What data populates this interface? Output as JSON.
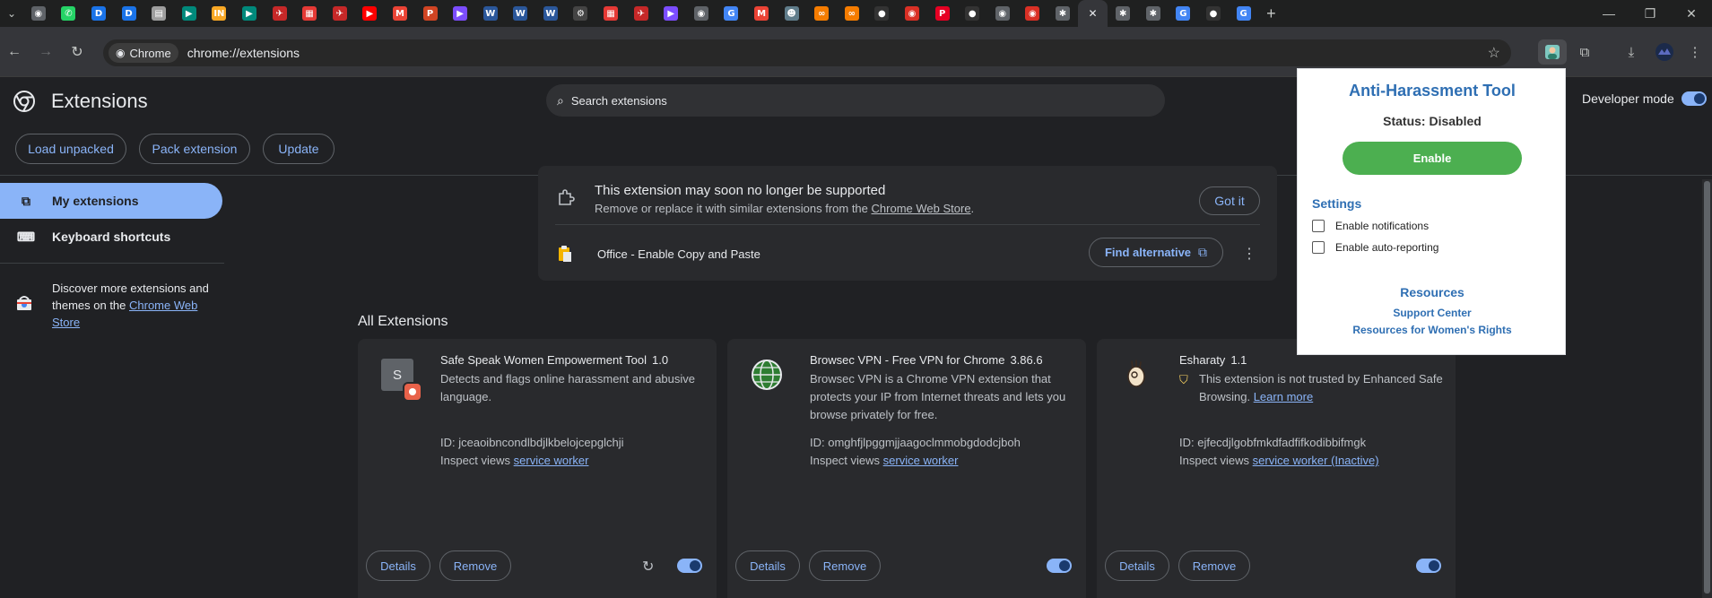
{
  "browser": {
    "tabs": [
      {
        "icon": "browser-icon",
        "color": "#5f6368",
        "glyph": "◉"
      },
      {
        "icon": "whatsapp-icon",
        "color": "#25d366",
        "glyph": "✆"
      },
      {
        "icon": "d-icon",
        "color": "#1a73e8",
        "glyph": "D"
      },
      {
        "icon": "d-icon",
        "color": "#1a73e8",
        "glyph": "D"
      },
      {
        "icon": "doc-icon",
        "color": "#9e9e9e",
        "glyph": "▤"
      },
      {
        "icon": "meet-icon",
        "color": "#00897b",
        "glyph": "▶"
      },
      {
        "icon": "in-icon",
        "color": "#f9a825",
        "glyph": "IN"
      },
      {
        "icon": "meet-icon",
        "color": "#00897b",
        "glyph": "▶"
      },
      {
        "icon": "airplane-icon",
        "color": "#c62828",
        "glyph": "✈"
      },
      {
        "icon": "calendar-icon",
        "color": "#e53935",
        "glyph": "▦"
      },
      {
        "icon": "airplane-icon",
        "color": "#c62828",
        "glyph": "✈"
      },
      {
        "icon": "youtube-icon",
        "color": "#ff0000",
        "glyph": "▶"
      },
      {
        "icon": "gmail-icon",
        "color": "#ea4335",
        "glyph": "M"
      },
      {
        "icon": "powerpoint-icon",
        "color": "#d04423",
        "glyph": "P"
      },
      {
        "icon": "play-icon",
        "color": "#7c4dff",
        "glyph": "▶"
      },
      {
        "icon": "word-icon",
        "color": "#2b579a",
        "glyph": "W"
      },
      {
        "icon": "word-icon",
        "color": "#2b579a",
        "glyph": "W"
      },
      {
        "icon": "word-icon",
        "color": "#2b579a",
        "glyph": "W"
      },
      {
        "icon": "openai-icon",
        "color": "#444444",
        "glyph": "⚙"
      },
      {
        "icon": "calendar-icon",
        "color": "#e53935",
        "glyph": "▦"
      },
      {
        "icon": "airplane-icon",
        "color": "#c62828",
        "glyph": "✈"
      },
      {
        "icon": "play-icon",
        "color": "#7c4dff",
        "glyph": "▶"
      },
      {
        "icon": "chrome-icon",
        "color": "#5f6368",
        "glyph": "◉"
      },
      {
        "icon": "google-icon",
        "color": "#4285f4",
        "glyph": "G"
      },
      {
        "icon": "gmail-icon",
        "color": "#ea4335",
        "glyph": "M"
      },
      {
        "icon": "owl-icon",
        "color": "#607d8b",
        "glyph": "☻"
      },
      {
        "icon": "infinity-icon",
        "color": "#f57c00",
        "glyph": "∞"
      },
      {
        "icon": "infinity-icon",
        "color": "#f57c00",
        "glyph": "∞"
      },
      {
        "icon": "github-icon",
        "color": "#333333",
        "glyph": "●"
      },
      {
        "icon": "chrome-colored-icon",
        "color": "#d93025",
        "glyph": "◉"
      },
      {
        "icon": "pinterest-icon",
        "color": "#e60023",
        "glyph": "P"
      },
      {
        "icon": "github-icon",
        "color": "#333333",
        "glyph": "●"
      },
      {
        "icon": "chrome-icon",
        "color": "#5f6368",
        "glyph": "◉"
      },
      {
        "icon": "chrome-colored-icon",
        "color": "#d93025",
        "glyph": "◉"
      },
      {
        "icon": "settings-icon",
        "color": "#5f6368",
        "glyph": "✱"
      },
      {
        "icon": "close-icon",
        "color": "#35363a",
        "glyph": "✕",
        "active": true
      },
      {
        "icon": "settings-icon",
        "color": "#5f6368",
        "glyph": "✱"
      },
      {
        "icon": "settings-icon",
        "color": "#5f6368",
        "glyph": "✱"
      },
      {
        "icon": "google-icon",
        "color": "#4285f4",
        "glyph": "G"
      },
      {
        "icon": "github-icon",
        "color": "#333333",
        "glyph": "●"
      },
      {
        "icon": "google-icon",
        "color": "#4285f4",
        "glyph": "G"
      }
    ],
    "chip_label": "Chrome",
    "url": "chrome://extensions"
  },
  "ext_page": {
    "title": "Extensions",
    "search_placeholder": "Search extensions",
    "dev_mode_label": "Developer mode",
    "buttons": {
      "load_unpacked": "Load unpacked",
      "pack_extension": "Pack extension",
      "update": "Update"
    },
    "sidebar": {
      "my_extensions": "My extensions",
      "keyboard_shortcuts": "Keyboard shortcuts",
      "discover_text": "Discover more extensions and themes on the ",
      "discover_link": "Chrome Web Store"
    },
    "notice": {
      "title": "This extension may soon no longer be supported",
      "sub_before": "Remove or replace it with similar extensions from the ",
      "sub_link": "Chrome Web Store",
      "sub_after": ".",
      "got_it": "Got it",
      "ext_name": "Office - Enable Copy and Paste",
      "find_alt": "Find alternative"
    },
    "section_title": "All Extensions",
    "cards": [
      {
        "name": "Safe Speak Women Empowerment Tool",
        "version": "1.0",
        "desc": "Detects and flags online harassment and abusive language.",
        "id": "ID: jceaoibncondlbdjlkbelojcepglchji",
        "inspect_label": "Inspect views ",
        "inspect_link": "service worker",
        "details": "Details",
        "remove": "Remove",
        "icon_letter": "S"
      },
      {
        "name": "Browsec VPN - Free VPN for Chrome",
        "version": "3.86.6",
        "desc": "Browsec VPN is a Chrome VPN extension that protects your IP from Internet threats and lets you browse privately for free.",
        "id": "ID: omghfjlpggmjjaagoclmmobgdodcjboh",
        "inspect_label": "Inspect views ",
        "inspect_link": "service worker",
        "details": "Details",
        "remove": "Remove"
      },
      {
        "name": "Esharaty",
        "version": "1.1",
        "warning": "This extension is not trusted by Enhanced Safe Browsing. ",
        "warning_link": "Learn more",
        "id": "ID: ejfecdjlgobfmkdfadfifkodibbifmgk",
        "inspect_label": "Inspect views ",
        "inspect_link": "service worker (Inactive)",
        "details": "Details",
        "remove": "Remove"
      }
    ]
  },
  "popup": {
    "title": "Anti-Harassment Tool",
    "status": "Status: Disabled",
    "enable_button": "Enable",
    "settings_heading": "Settings",
    "checkbox_notifications": "Enable notifications",
    "checkbox_auto_reporting": "Enable auto-reporting",
    "resources_heading": "Resources",
    "link_support": "Support Center",
    "link_rights": "Resources for Women's Rights"
  },
  "colors": {
    "accent": "#8ab4f8",
    "popup_title": "#2f6fb3",
    "enable_green": "#4caf50"
  }
}
